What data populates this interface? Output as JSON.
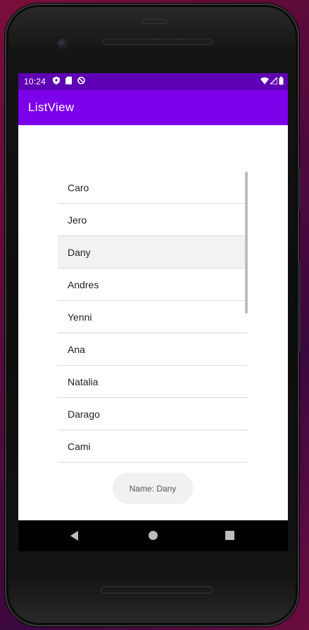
{
  "status_bar": {
    "time": "10:24",
    "left_icons": [
      "shield-icon",
      "sd-card-icon",
      "no-disturb-icon"
    ],
    "right_icons": [
      "wifi-icon",
      "signal-icon",
      "battery-icon"
    ]
  },
  "app_bar": {
    "title": "ListView"
  },
  "list": {
    "items": [
      {
        "label": "Caro",
        "selected": false
      },
      {
        "label": "Jero",
        "selected": false
      },
      {
        "label": "Dany",
        "selected": true
      },
      {
        "label": "Andres",
        "selected": false
      },
      {
        "label": "Yenni",
        "selected": false
      },
      {
        "label": "Ana",
        "selected": false
      },
      {
        "label": "Natalia",
        "selected": false
      },
      {
        "label": "Darago",
        "selected": false
      },
      {
        "label": "Cami",
        "selected": false
      }
    ]
  },
  "toast": {
    "text": "Name: Dany"
  },
  "nav_bar": {
    "buttons": [
      "back-icon",
      "home-icon",
      "recents-icon"
    ]
  },
  "colors": {
    "status_bar": "#5e00b4",
    "app_bar": "#7c00ea",
    "selected_row": "#f2f2f2"
  }
}
